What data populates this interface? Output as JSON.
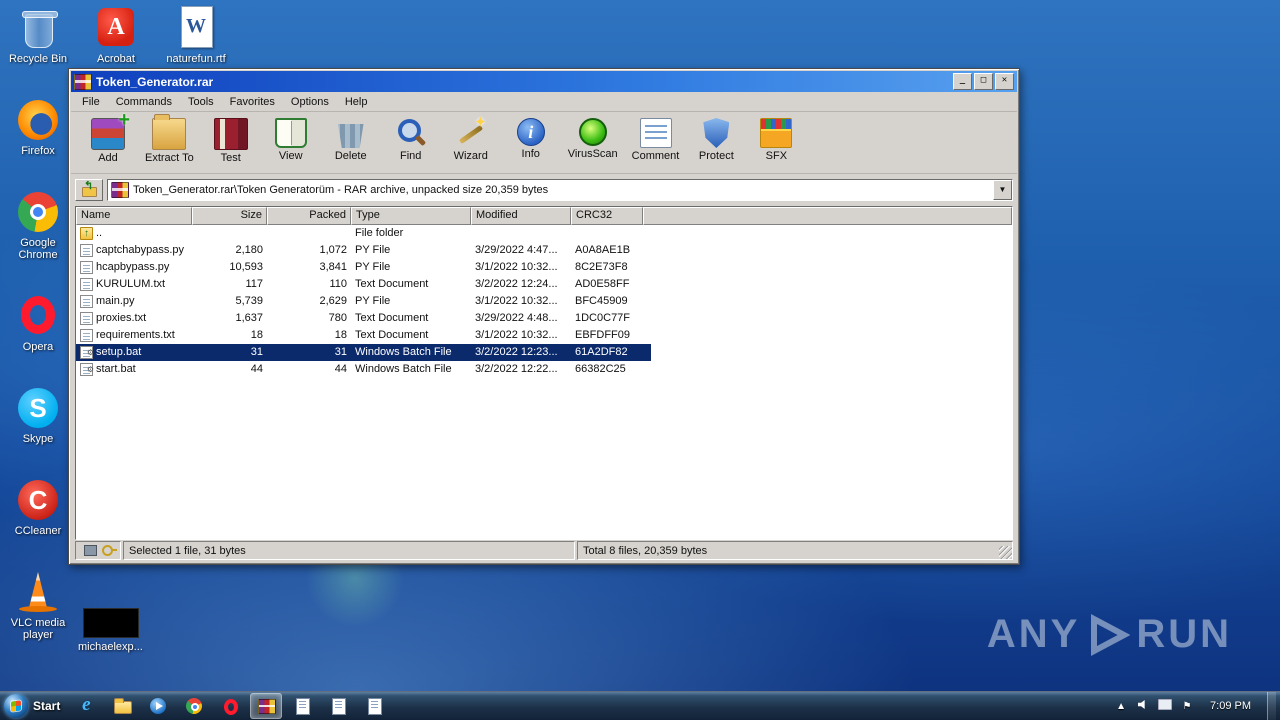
{
  "desktop": {
    "left_icons": [
      {
        "label": "Recycle Bin",
        "icon": "recycle-bin"
      },
      {
        "label": "Firefox",
        "icon": "firefox"
      },
      {
        "label": "Google Chrome",
        "icon": "chrome"
      },
      {
        "label": "Opera",
        "icon": "opera"
      },
      {
        "label": "Skype",
        "icon": "skype"
      },
      {
        "label": "CCleaner",
        "icon": "ccleaner"
      },
      {
        "label": "VLC media player",
        "icon": "vlc"
      }
    ],
    "top_icons": [
      {
        "label": "Acrobat",
        "icon": "acrobat"
      },
      {
        "label": "naturefun.rtf",
        "icon": "word-doc"
      }
    ],
    "extra_icons": [
      {
        "label": "michaelexp...",
        "icon": "black-box"
      }
    ],
    "watermark": {
      "brand_left": "ANY",
      "brand_right": "RUN"
    }
  },
  "window": {
    "title": "Token_Generator.rar",
    "controls": {
      "minimize": "_",
      "maximize": "□",
      "close": "✕"
    },
    "menu": [
      "File",
      "Commands",
      "Tools",
      "Favorites",
      "Options",
      "Help"
    ],
    "toolbar": [
      {
        "label": "Add",
        "icon": "add"
      },
      {
        "label": "Extract To",
        "icon": "extract"
      },
      {
        "label": "Test",
        "icon": "test"
      },
      {
        "label": "View",
        "icon": "view"
      },
      {
        "label": "Delete",
        "icon": "delete"
      },
      {
        "label": "Find",
        "icon": "find"
      },
      {
        "label": "Wizard",
        "icon": "wizard"
      },
      {
        "label": "Info",
        "icon": "info"
      },
      {
        "label": "VirusScan",
        "icon": "virusscan"
      },
      {
        "label": "Comment",
        "icon": "comment"
      },
      {
        "label": "Protect",
        "icon": "protect"
      },
      {
        "label": "SFX",
        "icon": "sfx"
      }
    ],
    "address": "Token_Generator.rar\\Token Generatorüm - RAR archive, unpacked size 20,359 bytes",
    "columns": [
      "Name",
      "Size",
      "Packed",
      "Type",
      "Modified",
      "CRC32"
    ],
    "rows": [
      {
        "name": "..",
        "size": "",
        "packed": "",
        "type": "File folder",
        "modified": "",
        "crc": "",
        "icon": "folder-up",
        "selected": false
      },
      {
        "name": "captchabypass.py",
        "size": "2,180",
        "packed": "1,072",
        "type": "PY File",
        "modified": "3/29/2022 4:47...",
        "crc": "A0A8AE1B",
        "icon": "doc",
        "selected": false
      },
      {
        "name": "hcapbypass.py",
        "size": "10,593",
        "packed": "3,841",
        "type": "PY File",
        "modified": "3/1/2022 10:32...",
        "crc": "8C2E73F8",
        "icon": "doc",
        "selected": false
      },
      {
        "name": "KURULUM.txt",
        "size": "117",
        "packed": "110",
        "type": "Text Document",
        "modified": "3/2/2022 12:24...",
        "crc": "AD0E58FF",
        "icon": "doc",
        "selected": false
      },
      {
        "name": "main.py",
        "size": "5,739",
        "packed": "2,629",
        "type": "PY File",
        "modified": "3/1/2022 10:32...",
        "crc": "BFC45909",
        "icon": "doc",
        "selected": false
      },
      {
        "name": "proxies.txt",
        "size": "1,637",
        "packed": "780",
        "type": "Text Document",
        "modified": "3/29/2022 4:48...",
        "crc": "1DC0C77F",
        "icon": "doc",
        "selected": false
      },
      {
        "name": "requirements.txt",
        "size": "18",
        "packed": "18",
        "type": "Text Document",
        "modified": "3/1/2022 10:32...",
        "crc": "EBFDFF09",
        "icon": "doc",
        "selected": false
      },
      {
        "name": "setup.bat",
        "size": "31",
        "packed": "31",
        "type": "Windows Batch File",
        "modified": "3/2/2022 12:23...",
        "crc": "61A2DF82",
        "icon": "bat",
        "selected": true
      },
      {
        "name": "start.bat",
        "size": "44",
        "packed": "44",
        "type": "Windows Batch File",
        "modified": "3/2/2022 12:22...",
        "crc": "66382C25",
        "icon": "bat",
        "selected": false
      }
    ],
    "status_left": "Selected 1 file, 31 bytes",
    "status_right": "Total 8 files, 20,359 bytes"
  },
  "taskbar": {
    "start_label": "Start",
    "buttons": [
      {
        "icon": "ie"
      },
      {
        "icon": "folder"
      },
      {
        "icon": "media"
      },
      {
        "icon": "chrome"
      },
      {
        "icon": "opera"
      },
      {
        "icon": "winrar",
        "active": true
      },
      {
        "icon": "doc"
      },
      {
        "icon": "doc"
      },
      {
        "icon": "doc"
      }
    ],
    "tray_icons": [
      {
        "icon": "hidden"
      },
      {
        "icon": "volume"
      },
      {
        "icon": "network"
      },
      {
        "icon": "flag"
      }
    ],
    "time": "7:09 PM"
  }
}
